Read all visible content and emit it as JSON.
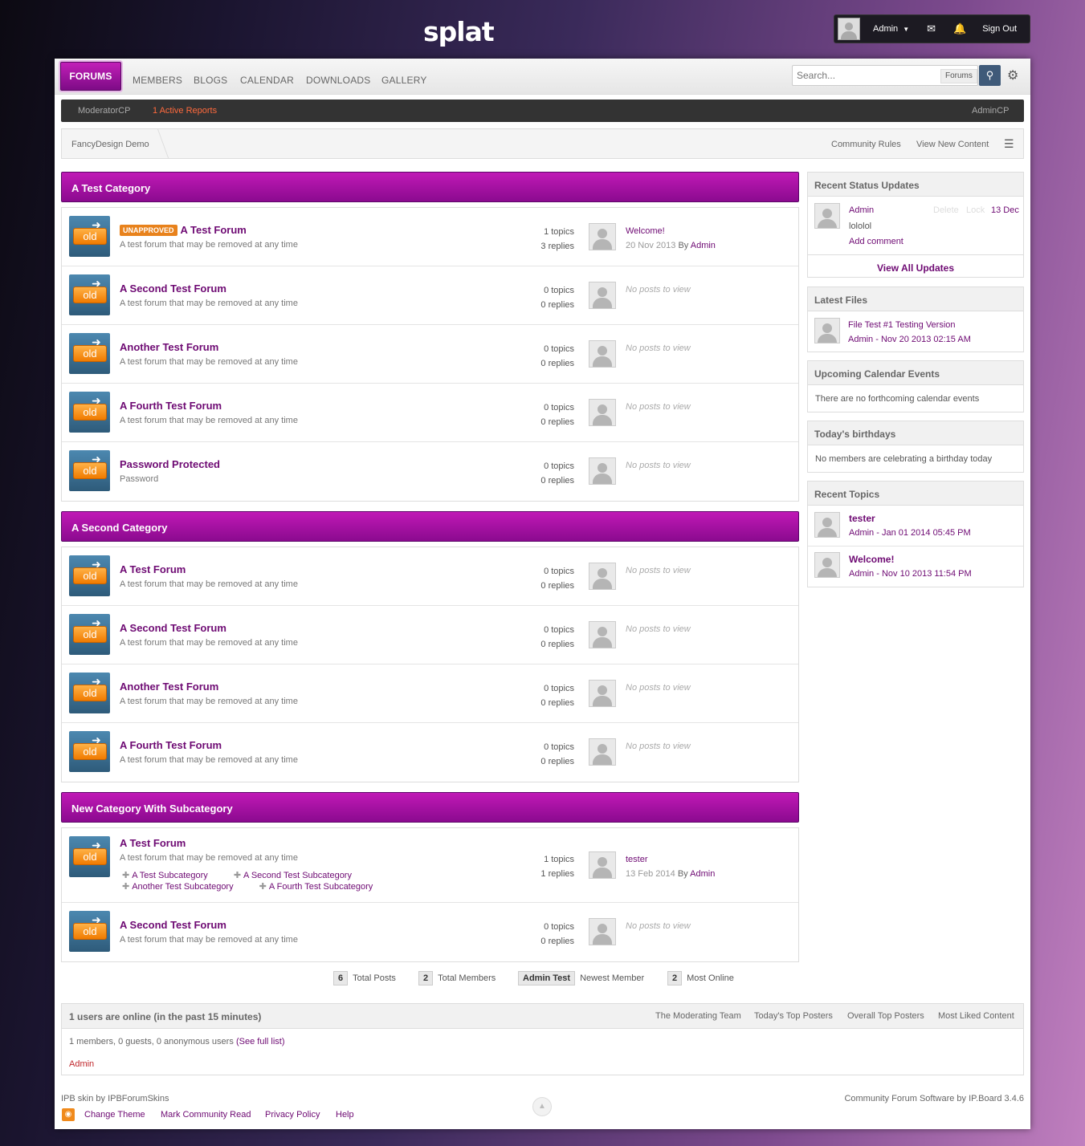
{
  "site": {
    "logo": "splat"
  },
  "user": {
    "name": "Admin",
    "sign_out": "Sign Out"
  },
  "nav": {
    "tabs": [
      "FORUMS",
      "MEMBERS",
      "BLOGS",
      "CALENDAR",
      "DOWNLOADS",
      "GALLERY"
    ],
    "search_placeholder": "Search...",
    "search_scope": "Forums"
  },
  "modbar": {
    "moderator": "ModeratorCP",
    "reports": "1 Active Reports",
    "admin": "AdminCP"
  },
  "breadcrumb": {
    "home": "FancyDesign Demo",
    "rules": "Community Rules",
    "new_content": "View New Content"
  },
  "icon_tag": "old",
  "categories": [
    {
      "title": "A Test Category",
      "forums": [
        {
          "badge": "UNAPPROVED",
          "title": "A Test Forum",
          "desc": "A test forum that may be removed at any time",
          "topics": "1 topics",
          "replies": "3 replies",
          "last_title": "Welcome!",
          "last_date": "20 Nov 2013",
          "last_by": "By",
          "last_author": "Admin"
        },
        {
          "title": "A Second Test Forum",
          "desc": "A test forum that may be removed at any time",
          "topics": "0 topics",
          "replies": "0 replies",
          "no_posts": "No posts to view"
        },
        {
          "title": "Another Test Forum",
          "desc": "A test forum that may be removed at any time",
          "topics": "0 topics",
          "replies": "0 replies",
          "no_posts": "No posts to view"
        },
        {
          "title": "A Fourth Test Forum",
          "desc": "A test forum that may be removed at any time",
          "topics": "0 topics",
          "replies": "0 replies",
          "no_posts": "No posts to view"
        },
        {
          "title": "Password Protected",
          "desc": "Password",
          "topics": "0 topics",
          "replies": "0 replies",
          "no_posts": "No posts to view"
        }
      ]
    },
    {
      "title": "A Second Category",
      "forums": [
        {
          "title": "A Test Forum",
          "desc": "A test forum that may be removed at any time",
          "topics": "0 topics",
          "replies": "0 replies",
          "no_posts": "No posts to view"
        },
        {
          "title": "A Second Test Forum",
          "desc": "A test forum that may be removed at any time",
          "topics": "0 topics",
          "replies": "0 replies",
          "no_posts": "No posts to view"
        },
        {
          "title": "Another Test Forum",
          "desc": "A test forum that may be removed at any time",
          "topics": "0 topics",
          "replies": "0 replies",
          "no_posts": "No posts to view"
        },
        {
          "title": "A Fourth Test Forum",
          "desc": "A test forum that may be removed at any time",
          "topics": "0 topics",
          "replies": "0 replies",
          "no_posts": "No posts to view"
        }
      ]
    },
    {
      "title": "New Category With Subcategory",
      "forums": [
        {
          "title": "A Test Forum",
          "desc": "A test forum that may be removed at any time",
          "topics": "1 topics",
          "replies": "1 replies",
          "last_title": "tester",
          "last_date": "13 Feb 2014",
          "last_by": "By",
          "last_author": "Admin",
          "subforums": [
            "A Test Subcategory",
            "A Second Test Subcategory",
            "Another Test Subcategory",
            "A Fourth Test Subcategory"
          ]
        },
        {
          "title": "A Second Test Forum",
          "desc": "A test forum that may be removed at any time",
          "topics": "0 topics",
          "replies": "0 replies",
          "no_posts": "No posts to view"
        }
      ]
    }
  ],
  "sidebar": {
    "status": {
      "title": "Recent Status Updates",
      "author": "Admin",
      "delete": "Delete",
      "lock": "Lock",
      "date": "13 Dec",
      "text": "lololol",
      "add_comment": "Add comment",
      "view_all": "View All Updates"
    },
    "files": {
      "title": "Latest Files",
      "name": "File Test #1 Testing Version",
      "meta": "Admin - Nov 20 2013 02:15 AM"
    },
    "calendar": {
      "title": "Upcoming Calendar Events",
      "text": "There are no forthcoming calendar events"
    },
    "birthdays": {
      "title": "Today's birthdays",
      "text": "No members are celebrating a birthday today"
    },
    "topics": {
      "title": "Recent Topics",
      "items": [
        {
          "title": "tester",
          "meta": "Admin - Jan 01 2014 05:45 PM"
        },
        {
          "title": "Welcome!",
          "meta": "Admin - Nov 10 2013 11:54 PM"
        }
      ]
    }
  },
  "stats": {
    "posts_num": "6",
    "posts_label": "Total Posts",
    "members_num": "2",
    "members_label": "Total Members",
    "newest_name": "Admin Test",
    "newest_label": "Newest Member",
    "online_num": "2",
    "online_label": "Most Online"
  },
  "online": {
    "title": "1 users are online (in the past 15 minutes)",
    "links": [
      "The Moderating Team",
      "Today's Top Posters",
      "Overall Top Posters",
      "Most Liked Content"
    ],
    "summary": "1 members, 0 guests, 0 anonymous users",
    "full_list": "(See full list)",
    "user": "Admin"
  },
  "footer": {
    "skin": "IPB skin by IPBForumSkins",
    "change_theme": "Change Theme",
    "mark_read": "Mark Community Read",
    "privacy": "Privacy Policy",
    "help": "Help",
    "software": "Community Forum Software by IP.Board 3.4.6"
  }
}
